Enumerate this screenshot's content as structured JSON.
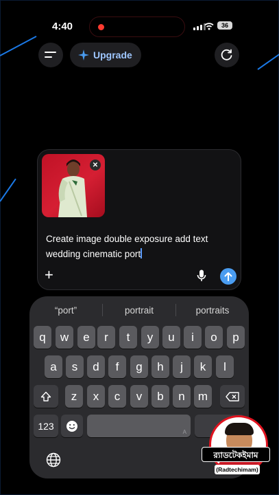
{
  "status": {
    "time": "4:40",
    "battery": "36"
  },
  "header": {
    "upgrade_label": "Upgrade"
  },
  "composer": {
    "prompt_text": "Create image double exposure add text wedding cinematic port"
  },
  "keyboard": {
    "suggestions": [
      "“port”",
      "portrait",
      "portraits"
    ],
    "row1": [
      "q",
      "w",
      "e",
      "r",
      "t",
      "y",
      "u",
      "i",
      "o",
      "p"
    ],
    "row2": [
      "a",
      "s",
      "d",
      "f",
      "g",
      "h",
      "j",
      "k",
      "l"
    ],
    "row3": [
      "z",
      "x",
      "c",
      "v",
      "b",
      "n",
      "m"
    ],
    "numbers_label": "123",
    "space_hint": "A"
  },
  "watermark": {
    "name": "র‍্যাডটেকইমাম",
    "handle": "(Radtechimam)"
  },
  "colors": {
    "accent": "#4a9cf0",
    "upgrade_text": "#9fc7ff",
    "record": "#ff3b30",
    "badge_red": "#e0131f"
  }
}
